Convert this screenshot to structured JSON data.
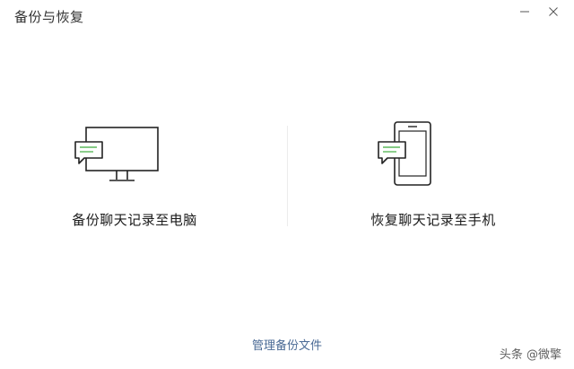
{
  "window": {
    "title": "备份与恢复"
  },
  "options": {
    "backup_label": "备份聊天记录至电脑",
    "restore_label": "恢复聊天记录至手机"
  },
  "footer": {
    "manage_label": "管理备份文件"
  },
  "watermark": {
    "text": "头条 @微擎"
  },
  "colors": {
    "accent": "#4a6a95",
    "chat_bubble_lines": "#5cb85c"
  },
  "icons": {
    "backup": "computer-chat-icon",
    "restore": "phone-chat-icon"
  }
}
